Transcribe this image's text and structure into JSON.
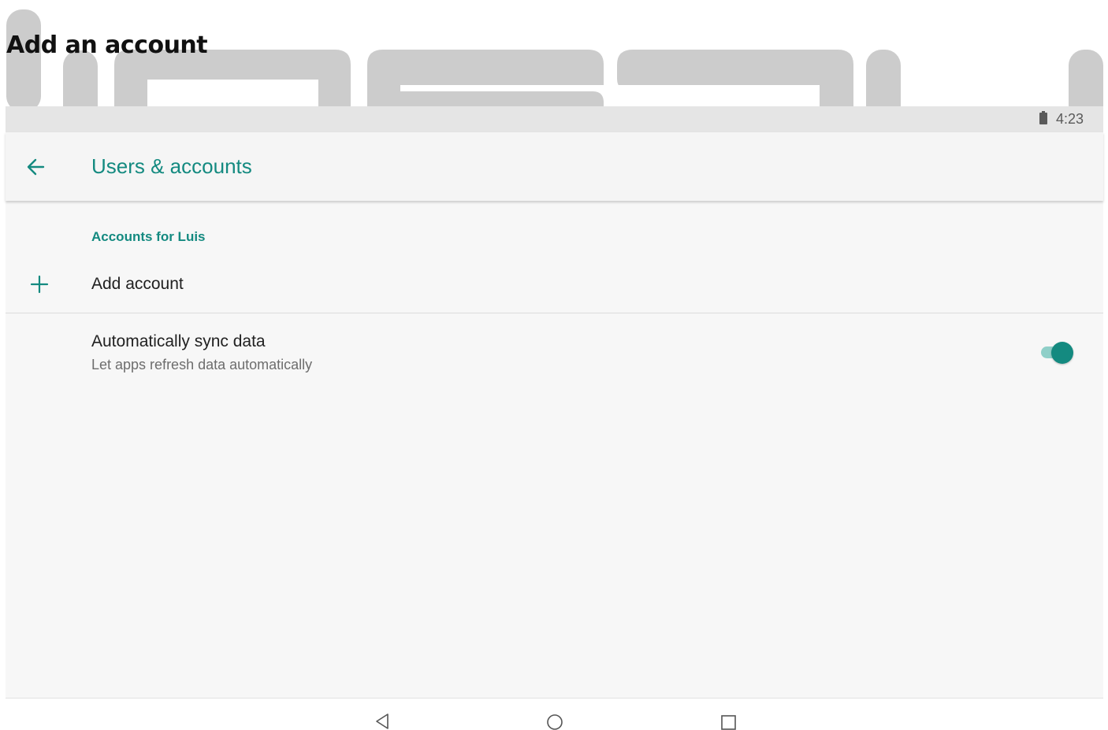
{
  "document": {
    "title": "Add an account"
  },
  "status_bar": {
    "time": "4:23",
    "battery_icon": "battery-full-icon"
  },
  "app_bar": {
    "title": "Users & accounts",
    "back_icon": "arrow-back-icon"
  },
  "accounts": {
    "section_header": "Accounts for Luis",
    "add_account": {
      "label": "Add account",
      "icon": "plus-icon"
    }
  },
  "sync": {
    "title": "Automatically sync data",
    "subtitle": "Let apps refresh data automatically",
    "enabled": true
  },
  "nav_bar": {
    "buttons": [
      "back-triangle-icon",
      "home-circle-icon",
      "recents-square-icon"
    ]
  },
  "colors": {
    "accent": "#148a80",
    "status_bar": "#e5e5e5",
    "background": "#f7f7f7",
    "watermark": "#cccccc"
  }
}
